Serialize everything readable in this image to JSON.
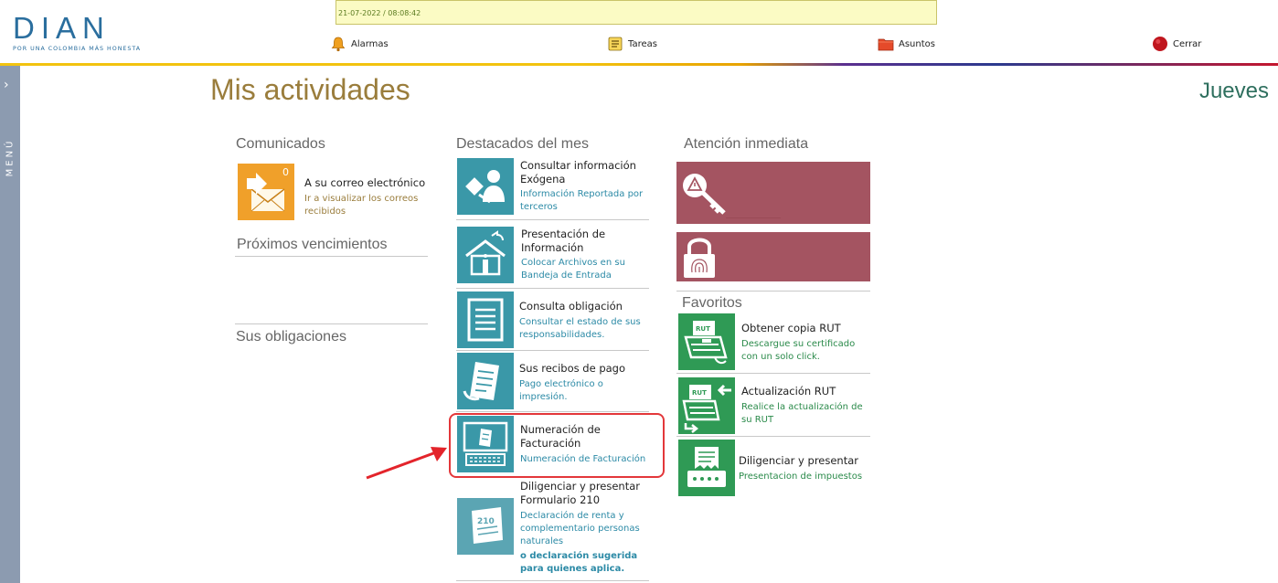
{
  "header": {
    "logo_text": "DIAN",
    "logo_tagline": "POR UNA COLOMBIA MÁS HONESTA",
    "notice_datetime": "21-07-2022 / 08:08:42",
    "nav": [
      {
        "label": "Alarmas",
        "icon": "bell-icon"
      },
      {
        "label": "Tareas",
        "icon": "task-list-icon"
      },
      {
        "label": "Asuntos",
        "icon": "folder-icon"
      },
      {
        "label": "Cerrar",
        "icon": "power-icon"
      }
    ]
  },
  "sidebar": {
    "label": "MENÚ",
    "arrow": "›"
  },
  "page": {
    "title": "Mis actividades",
    "day": "Jueves"
  },
  "comunicados": {
    "heading": "Comunicados",
    "count": "0",
    "item_title": "A su correo electrónico",
    "item_desc": "Ir a visualizar los correos recibidos"
  },
  "proximos": {
    "heading": "Próximos vencimientos"
  },
  "obligaciones": {
    "heading": "Sus obligaciones"
  },
  "destacados": {
    "heading": "Destacados del mes",
    "items": [
      {
        "title": "Consultar información Exógena",
        "desc": "Información Reportada por terceros",
        "icon": "person-document-icon"
      },
      {
        "title": "Presentación de Información",
        "desc": "Colocar Archivos en su Bandeja de Entrada",
        "icon": "house-upload-icon"
      },
      {
        "title": "Consulta obligación",
        "desc": "Consultar el estado de sus responsabilidades.",
        "icon": "document-lines-icon"
      },
      {
        "title": "Sus recibos de pago",
        "desc": "Pago electrónico o impresión.",
        "icon": "receipt-icon"
      },
      {
        "title": "Numeración de Facturación",
        "desc": "Numeración de Facturación",
        "icon": "invoice-keyboard-icon"
      },
      {
        "title": "Diligenciar y presentar Formulario 210",
        "desc": "Declaración de renta y complementario personas naturales",
        "desc_bold": "o declaración sugerida para quienes aplica.",
        "icon": "form-210-icon"
      }
    ]
  },
  "atencion": {
    "heading": "Atención inmediata",
    "buttons": [
      {
        "icon": "alert-key-icon"
      },
      {
        "icon": "fingerprint-lock-icon"
      }
    ]
  },
  "favoritos": {
    "heading": "Favoritos",
    "items": [
      {
        "title": "Obtener copia RUT",
        "desc": "Descargue su certificado con un solo click.",
        "icon": "rut-printer-icon"
      },
      {
        "title": "Actualización RUT",
        "desc": "Realice la actualización de su RUT",
        "icon": "rut-update-icon"
      },
      {
        "title": "Diligenciar y presentar",
        "desc": "Presentacion de impuestos",
        "icon": "tax-form-icon"
      }
    ]
  },
  "colors": {
    "teal": "#3a98a8",
    "orange": "#f0a02a",
    "green": "#2f9a55",
    "maroon": "#a45461",
    "highlight": "#e3373a"
  }
}
